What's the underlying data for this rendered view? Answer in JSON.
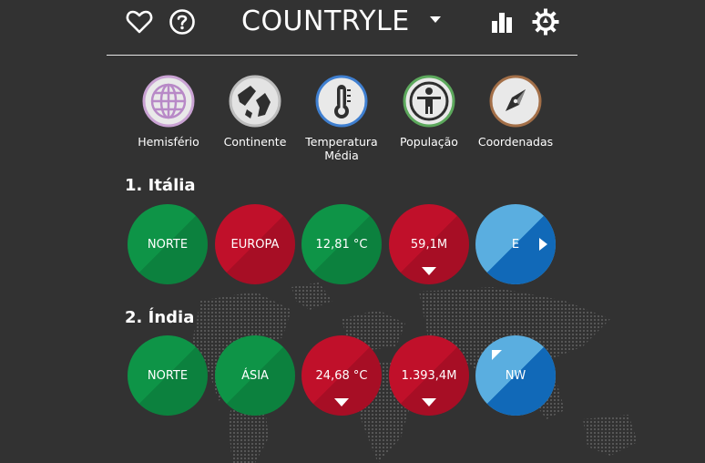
{
  "header": {
    "title": "COUNTRYLE"
  },
  "icons": {
    "heart": "heart-icon",
    "help": "help-icon",
    "stats": "bar-chart-icon",
    "settings": "gear-icon"
  },
  "categories": [
    {
      "label": "Hemisfério",
      "icon": "globe-icon",
      "color": "#d6b4dc"
    },
    {
      "label": "Continente",
      "icon": "continent-map-icon",
      "color": "#e3e3e3"
    },
    {
      "label": "Temperatura Média",
      "icon": "thermometer-icon",
      "color": "#3f7fd0"
    },
    {
      "label": "População",
      "icon": "person-icon",
      "color": "#5ca85c"
    },
    {
      "label": "Coordenadas",
      "icon": "compass-icon",
      "color": "#b07a52"
    }
  ],
  "guesses": [
    {
      "title": "1. Itália",
      "hints": [
        {
          "text": "NORTE",
          "status": "correct",
          "color": "#0e9447"
        },
        {
          "text": "EUROPA",
          "status": "wrong",
          "color": "#c0102a"
        },
        {
          "text": "12,81 °C",
          "status": "correct",
          "color": "#0e9447"
        },
        {
          "text": "59,1M",
          "status": "wrong-lower",
          "color": "#c0102a"
        },
        {
          "text": "E",
          "status": "direction-east",
          "color": "#5aaee0"
        }
      ]
    },
    {
      "title": "2. Índia",
      "hints": [
        {
          "text": "NORTE",
          "status": "correct",
          "color": "#0e9447"
        },
        {
          "text": "ÁSIA",
          "status": "correct",
          "color": "#0e9447"
        },
        {
          "text": "24,68 °C",
          "status": "wrong-lower",
          "color": "#c0102a"
        },
        {
          "text": "1.393,4M",
          "status": "wrong-lower",
          "color": "#c0102a"
        },
        {
          "text": "NW",
          "status": "direction-northwest",
          "color": "#5aaee0"
        }
      ]
    }
  ]
}
